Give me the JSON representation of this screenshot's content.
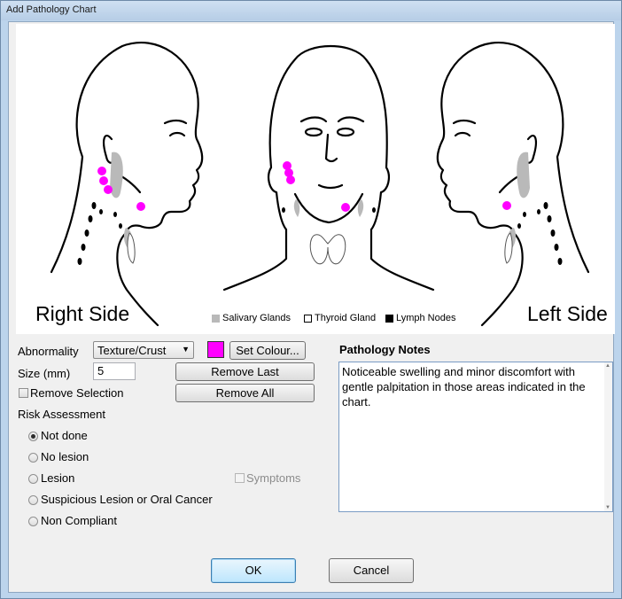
{
  "window": {
    "title": "Add Pathology Chart"
  },
  "chart": {
    "right_side_label": "Right Side",
    "left_side_label": "Left Side",
    "legend": [
      {
        "label": "Salivary Glands",
        "color": "#b9b9b9"
      },
      {
        "label": "Thyroid Gland",
        "color": "#ffffff"
      },
      {
        "label": "Lymph Nodes",
        "color": "#000000"
      }
    ],
    "marker_color": "#ff00ff"
  },
  "form": {
    "abnormality_label": "Abnormality",
    "abnormality_value": "Texture/Crust",
    "set_colour_label": "Set Colour...",
    "size_label": "Size (mm)",
    "size_value": "5",
    "remove_last_label": "Remove Last",
    "remove_selection_label": "Remove Selection",
    "remove_all_label": "Remove All",
    "risk_label": "Risk Assessment",
    "risk_options": [
      "Not done",
      "No lesion",
      "Lesion",
      "Suspicious Lesion or Oral Cancer",
      "Non Compliant"
    ],
    "risk_selected": "Not done",
    "symptoms_label": "Symptoms"
  },
  "notes": {
    "title": "Pathology Notes",
    "text": "Noticeable swelling and minor discomfort with gentle palpitation in those areas indicated in the chart."
  },
  "buttons": {
    "ok": "OK",
    "cancel": "Cancel"
  }
}
